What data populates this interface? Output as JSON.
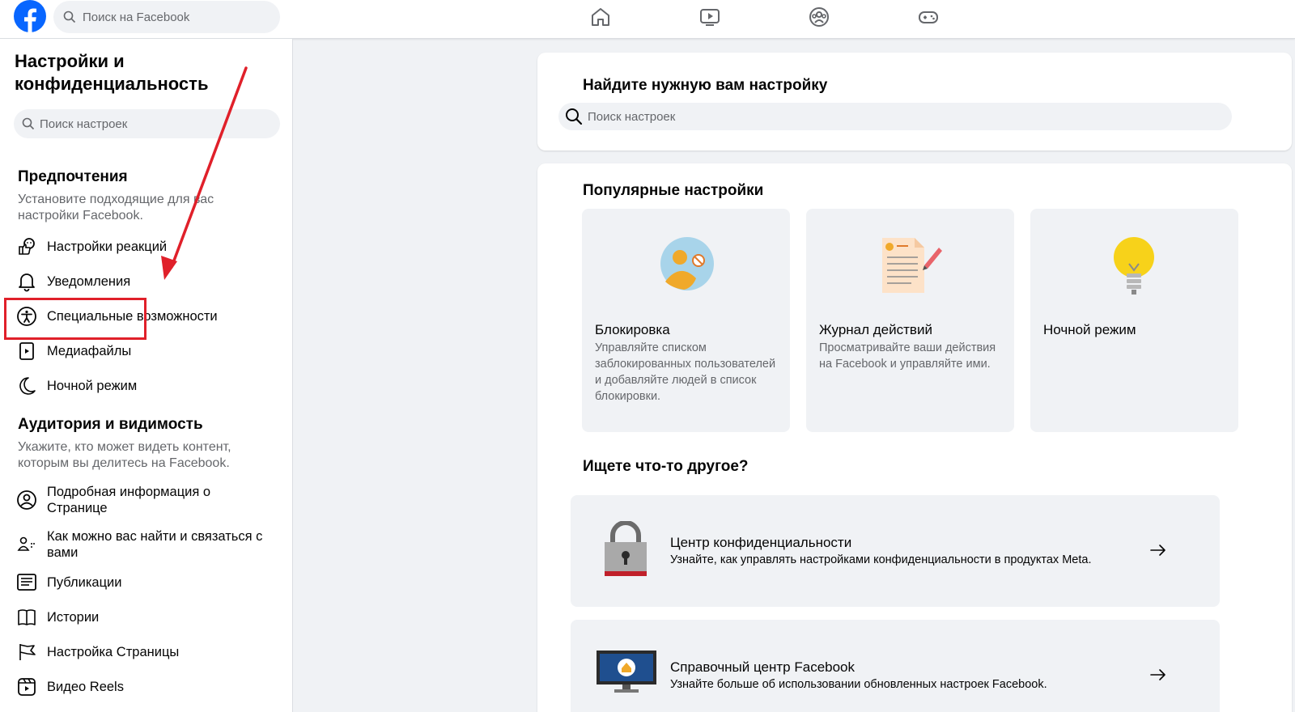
{
  "topbar": {
    "search_placeholder": "Поиск на Facebook",
    "nav_icons": [
      "home-icon",
      "watch-icon",
      "groups-icon",
      "gaming-icon"
    ]
  },
  "sidebar": {
    "title": "Настройки и конфиденциальность",
    "search_placeholder": "Поиск настроек",
    "section1": {
      "title": "Предпочтения",
      "desc": "Установите подходящие для вас настройки Facebook."
    },
    "items1": [
      {
        "label": "Настройки реакций",
        "icon": "reactions-icon"
      },
      {
        "label": "Уведомления",
        "icon": "bell-icon"
      },
      {
        "label": "Специальные возможности",
        "icon": "accessibility-icon"
      },
      {
        "label": "Медиафайлы",
        "icon": "media-icon"
      },
      {
        "label": "Ночной режим",
        "icon": "moon-icon"
      }
    ],
    "section2": {
      "title": "Аудитория и видимость",
      "desc": "Укажите, кто может видеть контент, которым вы делитесь на Facebook."
    },
    "items2": [
      {
        "label": "Подробная информация о Странице",
        "icon": "profile-icon"
      },
      {
        "label": "Как можно вас найти и связаться с вами",
        "icon": "people-icon"
      },
      {
        "label": "Публикации",
        "icon": "posts-icon"
      },
      {
        "label": "Истории",
        "icon": "stories-icon"
      },
      {
        "label": "Настройка Страницы",
        "icon": "flag-icon"
      },
      {
        "label": "Видео Reels",
        "icon": "reels-icon"
      }
    ]
  },
  "main": {
    "find_title": "Найдите нужную вам настройку",
    "search_placeholder": "Поиск настроек",
    "popular_title": "Популярные настройки",
    "tiles": [
      {
        "title": "Блокировка",
        "desc": "Управляйте списком заблокированных пользователей и добавляйте людей в список блокировки."
      },
      {
        "title": "Журнал действий",
        "desc": "Просматривайте ваши действия на Facebook и управляйте ими."
      },
      {
        "title": "Ночной режим",
        "desc": ""
      }
    ],
    "other_title": "Ищете что-то другое?",
    "rows": [
      {
        "title": "Центр конфиденциальности",
        "desc": "Узнайте, как управлять настройками конфиденциальности в продуктах Meta."
      },
      {
        "title": "Справочный центр Facebook",
        "desc": "Узнайте больше об использовании обновленных настроек Facebook."
      }
    ]
  },
  "colors": {
    "brand": "#0866ff",
    "annotation": "#e0202a"
  }
}
